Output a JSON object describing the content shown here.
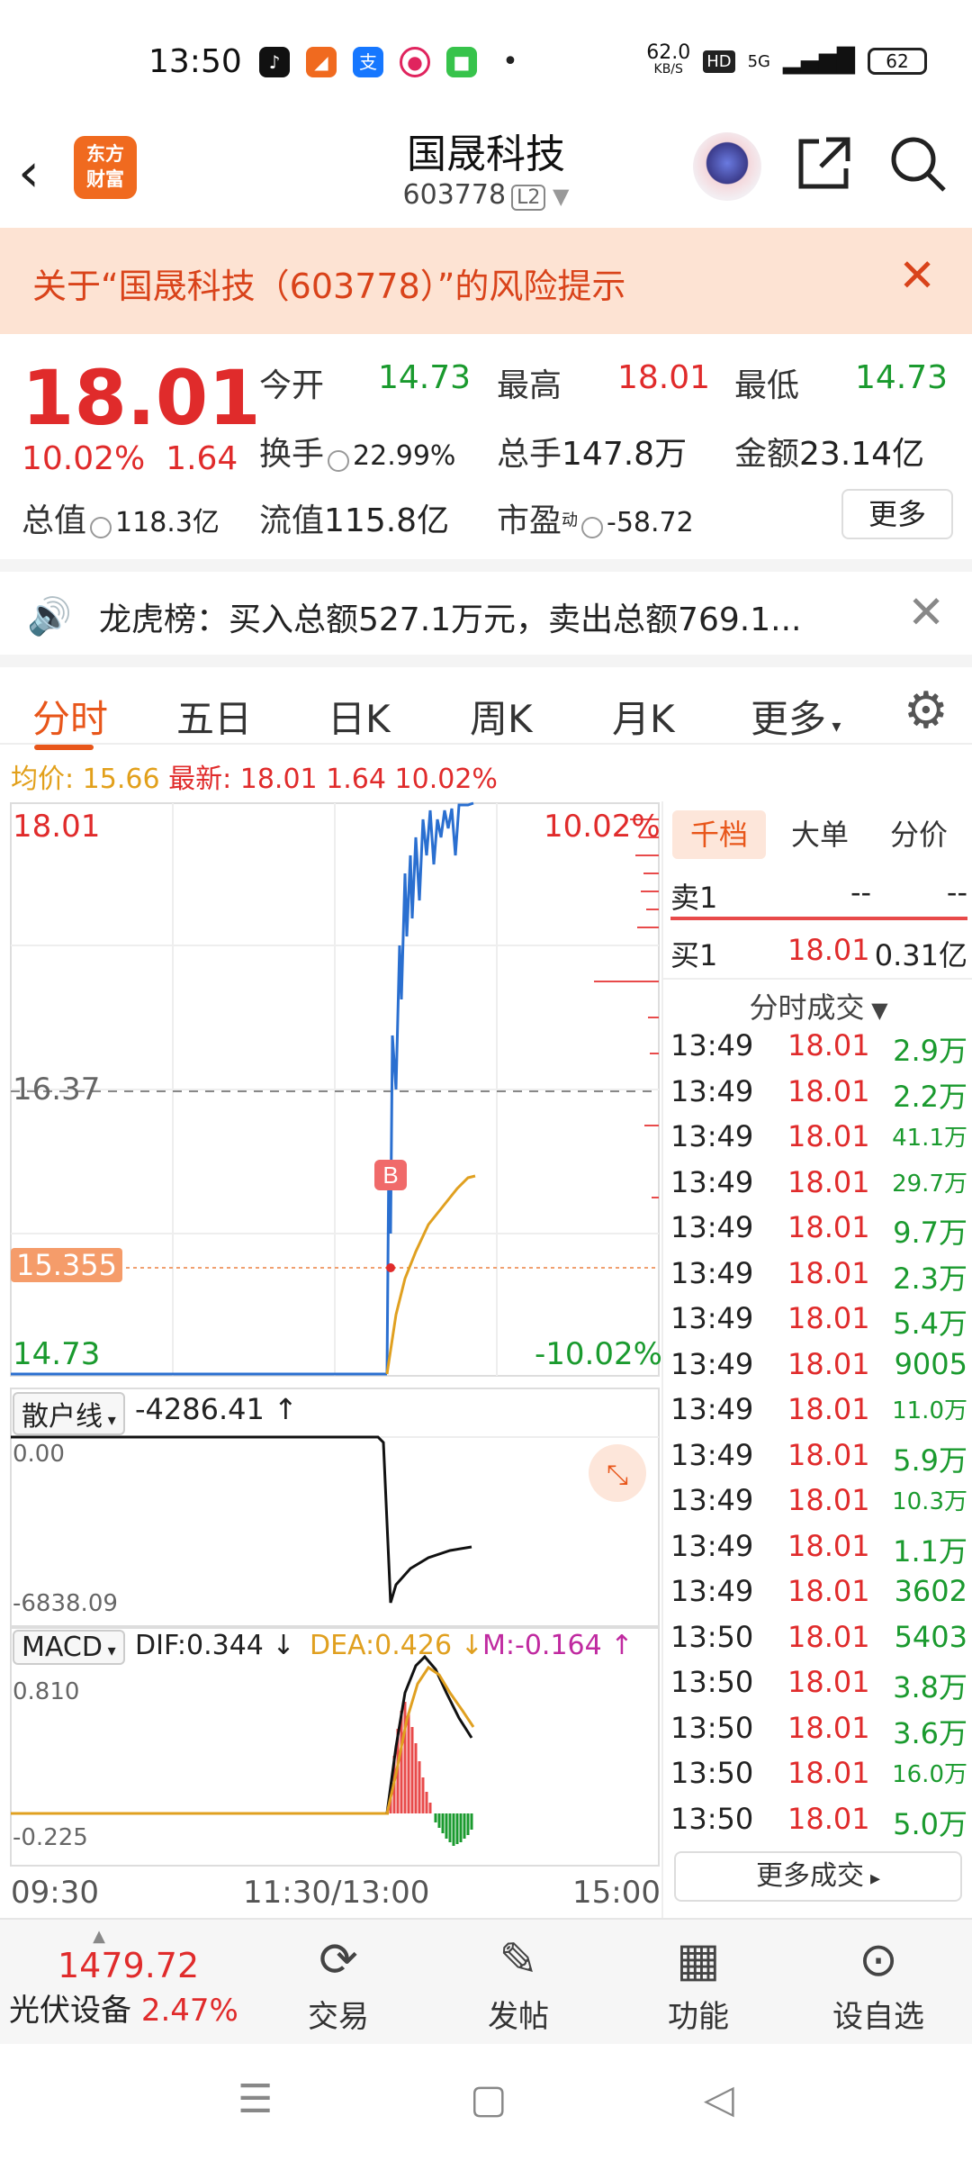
{
  "status": {
    "time": "13:50",
    "speed": "62.0",
    "speed_unit": "KB/S",
    "hd": "HD",
    "net": "5G",
    "battery": "62"
  },
  "header": {
    "logo_line1": "东方",
    "logo_line2": "财富",
    "title": "国晟科技",
    "code": "603778",
    "level": "L2"
  },
  "risk": {
    "text": "关于“国晟科技（603778）”的风险提示"
  },
  "quote": {
    "price": "18.01",
    "pct": "10.02%",
    "change": "1.64",
    "open_label": "今开",
    "open": "14.73",
    "high_label": "最高",
    "high": "18.01",
    "low_label": "最低",
    "low": "14.73",
    "turnover_label": "换手",
    "turnover": "22.99%",
    "volume_label": "总手",
    "volume": "147.8万",
    "amount_label": "金额",
    "amount": "23.14亿",
    "mktcap_label": "总值",
    "mktcap": "118.3亿",
    "float_label": "流值",
    "float": "115.8亿",
    "pe_label": "市盈",
    "pe_sup": "动",
    "pe": "-58.72",
    "more": "更多"
  },
  "dragon": {
    "text": "龙虎榜：买入总额527.1万元，卖出总额769.1..."
  },
  "tabs": [
    "分时",
    "五日",
    "日K",
    "周K",
    "月K",
    "更多"
  ],
  "infoline": {
    "avg_label": "均价:",
    "avg": "15.66",
    "latest_label": "最新:",
    "latest": "18.01",
    "chg": "1.64",
    "pct": "10.02%"
  },
  "main_chart": {
    "y_top": "18.01",
    "y_top_pct": "10.02%",
    "y_mid": "16.37",
    "y_bottom": "14.73",
    "y_bottom_pct": "-10.02%",
    "avg_marker": "15.355",
    "buy_marker": "B"
  },
  "retail": {
    "label": "散户线",
    "value": "-4286.41 ↑",
    "top": "0.00",
    "bottom": "-6838.09"
  },
  "macd": {
    "label": "MACD",
    "dif": "DIF:0.344 ↓",
    "dea": "DEA:0.426 ↓",
    "m": "M:-0.164 ↑",
    "top": "0.810",
    "bottom": "-0.225"
  },
  "time_axis": [
    "09:30",
    "11:30/13:00",
    "15:00"
  ],
  "right_panel": {
    "tabs": [
      "千档",
      "大单",
      "分价"
    ],
    "sell1_label": "卖1",
    "sell1_price": "--",
    "sell1_vol": "--",
    "buy1_label": "买1",
    "buy1_price": "18.01",
    "buy1_vol": "0.31亿",
    "trades_header": "分时成交",
    "trades": [
      {
        "t": "13:49",
        "p": "18.01",
        "v": "2.9万"
      },
      {
        "t": "13:49",
        "p": "18.01",
        "v": "2.2万"
      },
      {
        "t": "13:49",
        "p": "18.01",
        "v": "41.1万"
      },
      {
        "t": "13:49",
        "p": "18.01",
        "v": "29.7万"
      },
      {
        "t": "13:49",
        "p": "18.01",
        "v": "9.7万"
      },
      {
        "t": "13:49",
        "p": "18.01",
        "v": "2.3万"
      },
      {
        "t": "13:49",
        "p": "18.01",
        "v": "5.4万"
      },
      {
        "t": "13:49",
        "p": "18.01",
        "v": "9005"
      },
      {
        "t": "13:49",
        "p": "18.01",
        "v": "11.0万"
      },
      {
        "t": "13:49",
        "p": "18.01",
        "v": "5.9万"
      },
      {
        "t": "13:49",
        "p": "18.01",
        "v": "10.3万"
      },
      {
        "t": "13:49",
        "p": "18.01",
        "v": "1.1万"
      },
      {
        "t": "13:49",
        "p": "18.01",
        "v": "3602"
      },
      {
        "t": "13:50",
        "p": "18.01",
        "v": "5403"
      },
      {
        "t": "13:50",
        "p": "18.01",
        "v": "3.8万"
      },
      {
        "t": "13:50",
        "p": "18.01",
        "v": "3.6万"
      },
      {
        "t": "13:50",
        "p": "18.01",
        "v": "16.0万"
      },
      {
        "t": "13:50",
        "p": "18.01",
        "v": "5.0万"
      }
    ],
    "more_trades": "更多成交"
  },
  "bottombar": {
    "index_value": "1479.72",
    "index_name": "光伏设备",
    "index_pct": "2.47%",
    "items": [
      "交易",
      "发帖",
      "功能",
      "设自选"
    ]
  }
}
